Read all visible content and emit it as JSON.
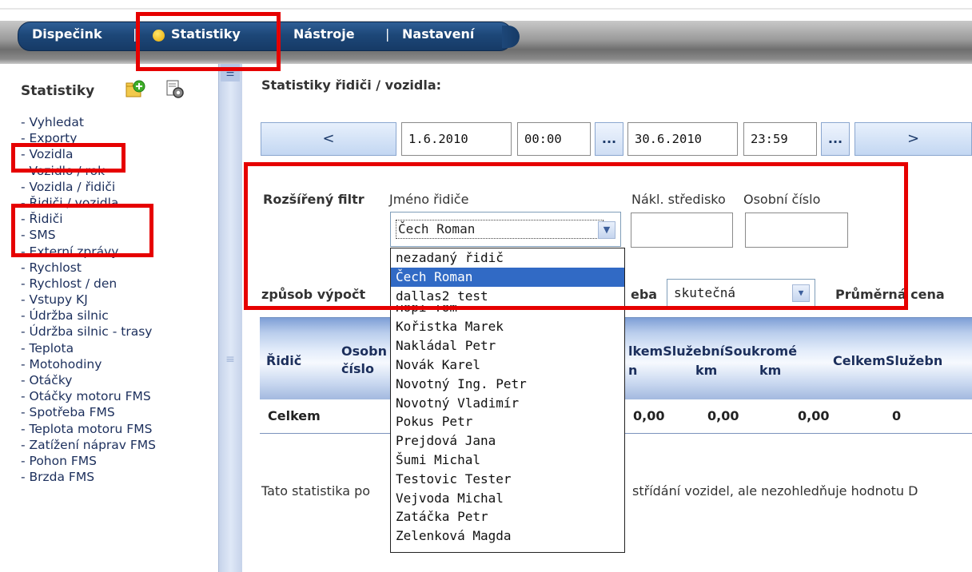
{
  "nav": {
    "items": [
      "Dispečink",
      "Statistiky",
      "Nástroje",
      "Nastavení"
    ],
    "active": "Statistiky"
  },
  "sidebar": {
    "title": "Statistiky",
    "items": [
      "- Vyhledat",
      "- Exporty",
      "- Vozidla",
      "- Vozidlo / rok",
      "- Vozidla / řidiči",
      "- Řidiči / vozidla",
      "- Řidiči",
      "- SMS",
      "- Externí zprávy",
      "- Rychlost",
      "- Rychlost / den",
      "- Vstupy KJ",
      "- Údržba silnic",
      "- Údržba silnic - trasy",
      "- Teplota",
      "- Motohodiny",
      "- Otáčky",
      "- Otáčky motoru FMS",
      "- Spotřeba FMS",
      "- Teplota motoru FMS",
      "- Zatížení náprav FMS",
      "- Pohon FMS",
      "- Brzda FMS"
    ]
  },
  "main": {
    "title": "Statistiky řidiči / vozidla:",
    "date_nav": {
      "prev": "<",
      "from_date": "1.6.2010",
      "from_time": "00:00",
      "dots": "...",
      "to_date": "30.6.2010",
      "to_time": "23:59",
      "next": ">"
    },
    "filter": {
      "label": "Rozšířený filtr",
      "driver_label": "Jméno řidiče",
      "cost_center_label": "Nákl. středisko",
      "personal_no_label": "Osobní číslo",
      "driver_selected": "Čech Roman",
      "calc_label": "způsob výpočt",
      "consumption_fragment": "eba",
      "consumption_value": "skutečná",
      "avg_price_label": "Průměrná cena"
    },
    "driver_options": [
      "nezadaný řidič",
      "Čech Roman",
      "dallas2 test",
      "Hopi Tom",
      "Kořistka Marek",
      "Nakládal Petr",
      "Novák Karel",
      "Novotný Ing. Petr",
      "Novotný Vladimír",
      "Pokus Petr",
      "Prejdová Jana",
      "Šumi Michal",
      "Testovic Tester",
      "Vejvoda Michal",
      "Zatáčka Petr",
      "Zelenková Magda"
    ],
    "table": {
      "h_driver": "Řidič",
      "h_personal_1": "Osobn",
      "h_personal_2": "číslo",
      "h_group": "lkemSlužebníSoukromé",
      "h_km_1": "n",
      "h_km_2": "km",
      "h_km_3": "km",
      "h_group2": "CelkemSlužebn",
      "row_label": "Celkem",
      "v1": "0,00",
      "v2": "0,00",
      "v3": "0,00",
      "v4": "0"
    },
    "note_left": "Tato statistika po",
    "note_right": "střídání vozidel, ale nezohledňuje hodnotu D"
  }
}
